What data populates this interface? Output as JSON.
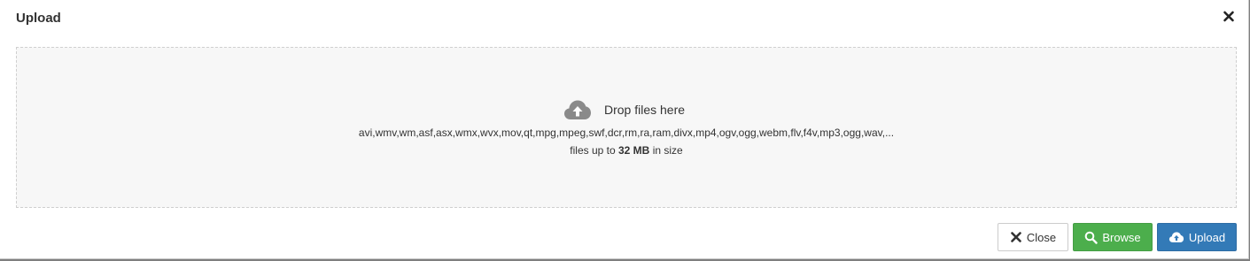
{
  "dialog": {
    "title": "Upload",
    "close_glyph": "×"
  },
  "dropzone": {
    "icon": "cloud-upload-icon",
    "label": "Drop files here",
    "extensions": "avi,wmv,wm,asf,asx,wmx,wvx,mov,qt,mpg,mpeg,swf,dcr,rm,ra,ram,divx,mp4,ogv,ogg,webm,flv,f4v,mp3,ogg,wav,...",
    "size_prefix": "files up to",
    "size_value": "32 MB",
    "size_suffix": "in size"
  },
  "footer": {
    "close_label": "Close",
    "browse_label": "Browse",
    "upload_label": "Upload",
    "close_icon": "times-icon",
    "browse_icon": "search-icon",
    "upload_icon": "cloud-upload-icon"
  },
  "colors": {
    "browse_bg": "#4cae4c",
    "upload_bg": "#337ab7",
    "dropzone_bg": "#f7f7f7"
  }
}
